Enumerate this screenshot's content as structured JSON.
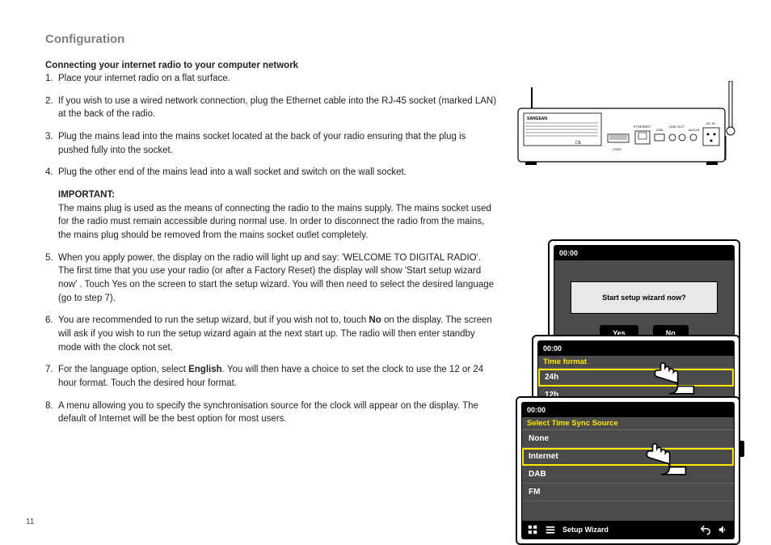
{
  "page_number": "11",
  "title": "Configuration",
  "subheading": "Connecting your internet radio to your computer network",
  "steps": {
    "s1": "Place your internet radio on a flat surface.",
    "s2": "If you wish to use a wired network connection, plug the Ethernet cable into the RJ-45 socket (marked LAN) at the back of the radio.",
    "s3": "Plug the mains lead into the mains socket located at the back of your radio ensuring that the plug is pushed fully into the socket.",
    "s4": "Plug the other end of the mains lead into a wall socket and switch on the wall socket.",
    "important_label": "IMPORTANT:",
    "important_body": "The mains plug is used as the means of connecting the radio to the mains supply. The mains socket used for the radio must remain accessible during normal use. In order to disconnect the radio from the mains, the mains plug should be removed from the mains socket outlet completely.",
    "s5a": "When you apply power, the display on the radio will light up and say: 'WELCOME TO DIGITAL RADIO'. The first time that you use your radio (or after a Factory Reset) the display will show 'Start setup wizard now' . Touch Yes on the screen to start the setup wizard. You will then need to select the desired language (go to step 7).",
    "s6a": "You are recommended to run the setup wizard, but if you wish not to, touch ",
    "s6b": "No",
    "s6c": " on the display. The screen will ask if you wish to run the setup wizard again at the next start up. The radio will then enter standby mode with the clock not set.",
    "s7a": "For the language option, select ",
    "s7b": "English",
    "s7c": ". You will then have a choice to set the clock to use the 12 or 24 hour format. Touch the desired hour format.",
    "s8": "A menu allowing you to specify the synchronisation source for the clock will appear on the display. The default of Internet will be the best option for most users."
  },
  "screens": {
    "clock": "00:00",
    "wizard_question": "Start setup wizard now?",
    "yes": "Yes",
    "no": "No",
    "time_format_title": "Time format",
    "fmt24": "24h",
    "fmt12": "12h",
    "sync_title": "Select Time Sync Source",
    "sync_none": "None",
    "sync_internet": "Internet",
    "sync_dab": "DAB",
    "sync_fm": "FM",
    "footer_label": "Setup Wizard"
  },
  "rear_panel": {
    "brand": "SANGEAN",
    "labels": [
      "I-POD",
      "ETHERNET",
      "USB",
      "LINE OUT",
      "AUX IN",
      "AC IN"
    ]
  }
}
